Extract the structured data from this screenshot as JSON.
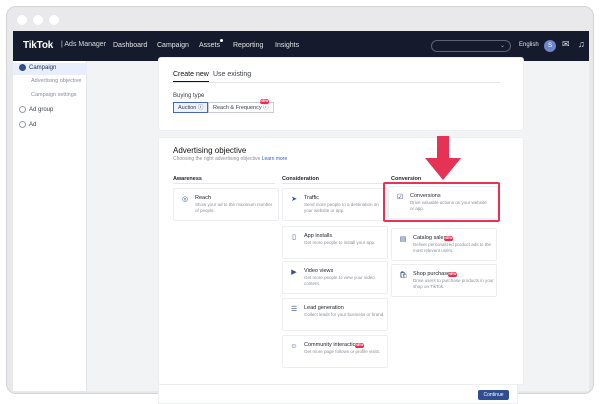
{
  "brand": {
    "logo": "TikTok",
    "product": "Ads Manager"
  },
  "topnav": {
    "items": [
      "Dashboard",
      "Campaign",
      "Assets",
      "Reporting",
      "Insights"
    ],
    "language": "English",
    "avatar_initial": "S"
  },
  "sidebar": {
    "campaign": "Campaign",
    "sub_items": [
      "Advertising objective",
      "Campaign settings"
    ],
    "ad_group": "Ad group",
    "ad": "Ad"
  },
  "create": {
    "tabs": [
      "Create new",
      "Use existing"
    ],
    "buying_type_label": "Buying type",
    "buying_options": [
      "Auction",
      "Reach & Frequency"
    ],
    "new_badge": "NEW"
  },
  "objective": {
    "title": "Advertising objective",
    "subtitle": "Choosing the right advertising objective",
    "learn_more": "Learn more",
    "columns": [
      "Awareness",
      "Consideration",
      "Conversion"
    ],
    "awareness": [
      {
        "icon": "target-icon",
        "title": "Reach",
        "desc": "Show your ad to the maximum number of people."
      }
    ],
    "consideration": [
      {
        "icon": "cursor-icon",
        "title": "Traffic",
        "desc": "Send more people to a destination on your website or app."
      },
      {
        "icon": "phone-icon",
        "title": "App installs",
        "desc": "Get more people to install your app."
      },
      {
        "icon": "video-icon",
        "title": "Video views",
        "desc": "Get more people to view your video content."
      },
      {
        "icon": "form-icon",
        "title": "Lead generation",
        "desc": "Collect leads for your business or brand."
      },
      {
        "icon": "people-icon",
        "title": "Community interaction",
        "desc": "Get more page follows or profile visits."
      }
    ],
    "conversion": [
      {
        "icon": "check-icon",
        "title": "Conversions",
        "desc": "Drive valuable actions on your website or app."
      },
      {
        "icon": "catalog-icon",
        "title": "Catalog sales",
        "desc": "Deliver personalized product ads to the most relevant users."
      },
      {
        "icon": "shop-icon",
        "title": "Shop purchases",
        "desc": "Drive users to purchase products in your shop on TikTok."
      }
    ]
  },
  "footer": {
    "continue": "Continue"
  },
  "colors": {
    "nav_bg": "#151b2c",
    "accent": "#2f4d8f",
    "highlight": "#e63255"
  }
}
